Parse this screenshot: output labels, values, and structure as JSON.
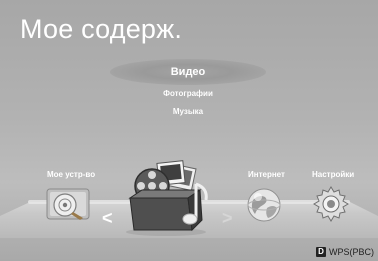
{
  "header": {
    "title": "Мое содерж."
  },
  "content_menu": {
    "items": [
      {
        "label": "Видео",
        "selected": true
      },
      {
        "label": "Фотографии",
        "selected": false
      },
      {
        "label": "Музыка",
        "selected": false
      }
    ]
  },
  "categories": {
    "my_device": {
      "label": "Мое устр-во",
      "icon": "disc-drive-icon"
    },
    "my_content": {
      "icon": "media-box-icon"
    },
    "internet": {
      "label": "Интернет",
      "icon": "globe-icon"
    },
    "settings": {
      "label": "Настройки",
      "icon": "gear-icon"
    }
  },
  "nav": {
    "left_arrow": "<",
    "right_arrow": ">"
  },
  "footer": {
    "key": "D",
    "label": "WPS(PBC)"
  },
  "colors": {
    "background": "#b0b0b0",
    "text": "#ffffff",
    "shelf": "#d0d0d0",
    "key_bg": "#222222"
  }
}
